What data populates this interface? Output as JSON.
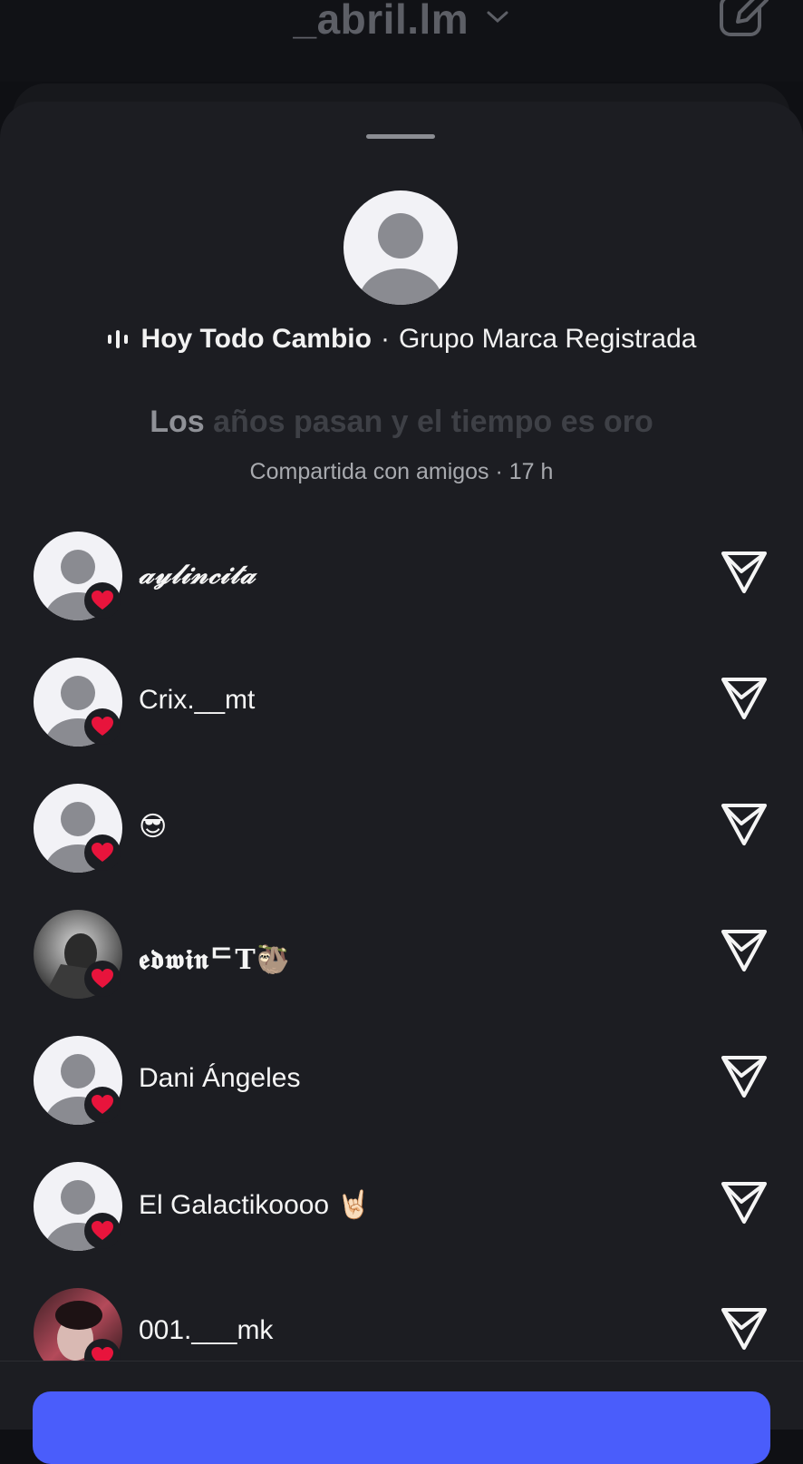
{
  "header": {
    "account_name": "_abril.lm",
    "icons": [
      "chevron-down-icon",
      "compose-icon"
    ]
  },
  "song": {
    "title": "Hoy Todo Cambio",
    "separator": "·",
    "artist": "Grupo Marca Registrada",
    "icon": "equalizer-icon"
  },
  "lyric": {
    "active": "Los",
    "upcoming": "años pasan y el tiempo es oro"
  },
  "shared_line": "Compartida con amigos · 17 h",
  "likes": [
    {
      "name": "𝒶𝓎𝓁𝒾𝓃𝒸𝒾𝓉𝒶",
      "avatar": "default"
    },
    {
      "name": "Crix.__mt",
      "avatar": "default"
    },
    {
      "name": "😎",
      "avatar": "default"
    },
    {
      "name": "𝖊𝖉𝖜𝖎𝖓ᄃT🦥",
      "avatar": "photo"
    },
    {
      "name": "Dani Ángeles",
      "avatar": "default"
    },
    {
      "name": "El Galactikoooo 🤘🏻",
      "avatar": "default"
    },
    {
      "name": "001.___mk",
      "avatar": "photo"
    }
  ],
  "colors": {
    "background": "#1c1d22",
    "heart": "#e8143c",
    "primary_button": "#4a5dfb"
  }
}
